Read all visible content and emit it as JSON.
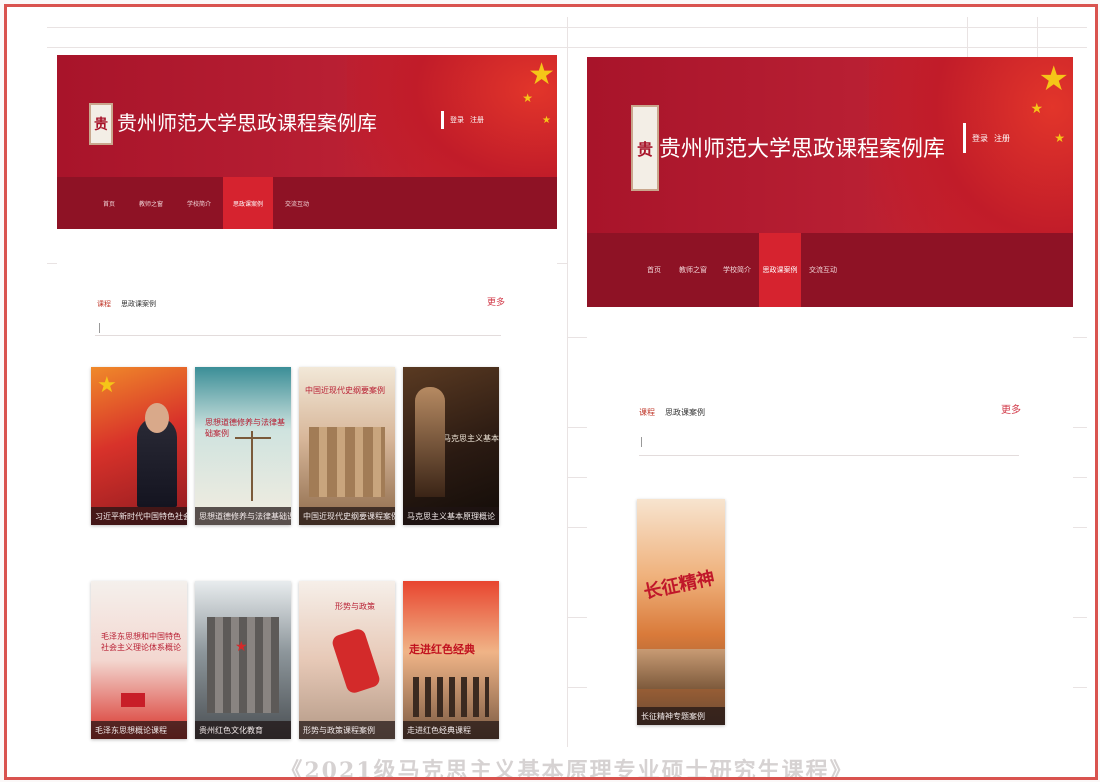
{
  "site": {
    "title": "贵州师范大学思政课程案例库",
    "seal_text": "贵",
    "toplinks": [
      "登录",
      "注册"
    ]
  },
  "left_shot": {
    "nav": [
      "首页",
      "教师之窗",
      "学校简介",
      "思政课案例",
      "交流互动"
    ],
    "active_nav_index": 3,
    "section_tag": "课程",
    "section_title": "思政课案例",
    "more_label": "更多",
    "cards": [
      {
        "title": "",
        "caption": "习近平新时代中国特色社会主义思想",
        "theme": "red-portrait"
      },
      {
        "title": "思想道德修养与法律基础案例",
        "caption": "思想道德修养与法律基础课",
        "theme": "teal-scale"
      },
      {
        "title": "中国近现代史纲要案例",
        "caption": "中国近现代史纲要课程案例",
        "theme": "ruins"
      },
      {
        "title": "马克思主义基本原理",
        "caption": "马克思主义基本原理概论",
        "theme": "dark-scholars"
      },
      {
        "title": "毛泽东思想和中国特色社会主义理论体系概论",
        "caption": "毛泽东思想概论课程",
        "theme": "red-flag"
      },
      {
        "title": "",
        "caption": "贵州红色文化教育",
        "theme": "building"
      },
      {
        "title": "形势与政策",
        "caption": "形势与政策课程案例",
        "theme": "fist"
      },
      {
        "title": "走进红色经典",
        "caption": "走进红色经典课程",
        "theme": "red-march"
      }
    ]
  },
  "right_shot": {
    "nav": [
      "首页",
      "教师之窗",
      "学校简介",
      "思政课案例",
      "交流互动"
    ],
    "active_nav_index": 3,
    "section_tag": "课程",
    "section_title": "思政课案例",
    "more_label": "更多",
    "cards": [
      {
        "title": "长征精神",
        "caption": "长征精神专题案例",
        "theme": "long-march"
      }
    ]
  },
  "page_caption": "《2021级马克思主义基本原理专业硕士研究生课程》",
  "colors": {
    "banner": "#b81f33",
    "nav": "#8e1225",
    "nav_active": "#d6232f",
    "frame": "#d9534f"
  }
}
